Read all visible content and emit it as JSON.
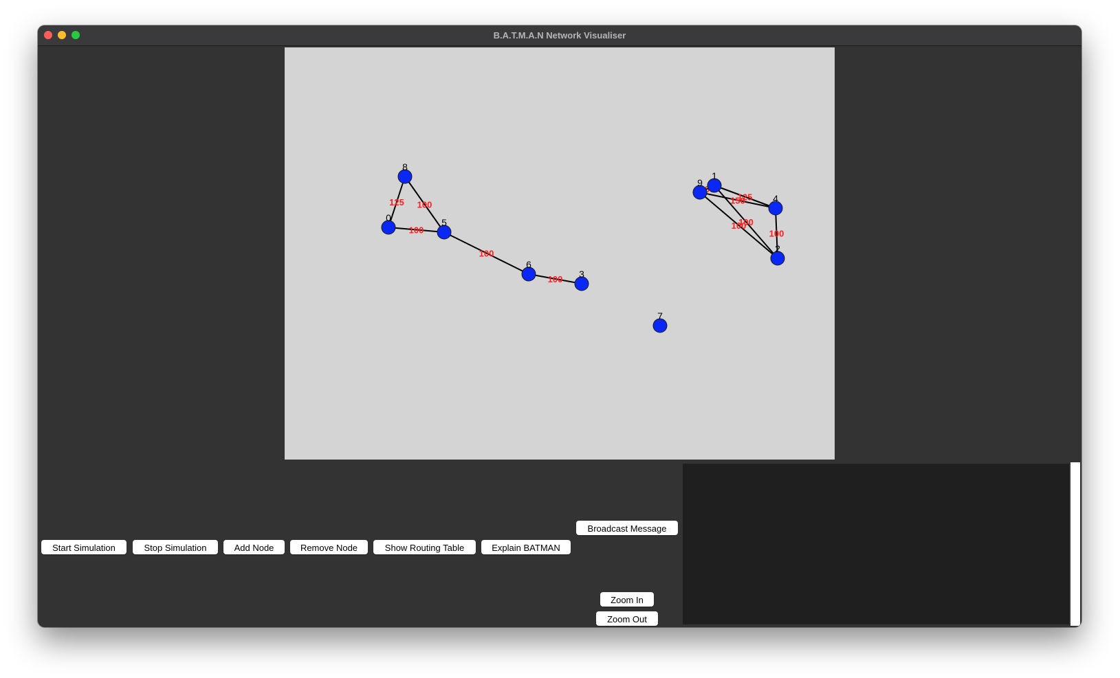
{
  "window": {
    "title": "B.A.T.M.A.N Network Visualiser"
  },
  "toolbar": {
    "start_label": "Start Simulation",
    "stop_label": "Stop Simulation",
    "add_label": "Add Node",
    "remove_label": "Remove Node",
    "routing_label": "Show Routing Table",
    "explain_label": "Explain BATMAN",
    "broadcast_label": "Broadcast Message",
    "zoom_in_label": "Zoom In",
    "zoom_out_label": "Zoom Out"
  },
  "network": {
    "nodes": [
      {
        "id": "0"
      },
      {
        "id": "1"
      },
      {
        "id": "2"
      },
      {
        "id": "3"
      },
      {
        "id": "4"
      },
      {
        "id": "5"
      },
      {
        "id": "6"
      },
      {
        "id": "7"
      },
      {
        "id": "8"
      },
      {
        "id": "9"
      }
    ],
    "edges": [
      {
        "from": "8",
        "to": "0",
        "label": "125"
      },
      {
        "from": "8",
        "to": "5",
        "label": "100"
      },
      {
        "from": "0",
        "to": "5",
        "label": "100"
      },
      {
        "from": "5",
        "to": "6",
        "label": "100"
      },
      {
        "from": "6",
        "to": "3",
        "label": "100"
      },
      {
        "from": "9",
        "to": "1",
        "label": "100"
      },
      {
        "from": "1",
        "to": "4",
        "label": "125"
      },
      {
        "from": "9",
        "to": "4",
        "label": "150"
      },
      {
        "from": "1",
        "to": "2",
        "label": "100"
      },
      {
        "from": "9",
        "to": "2",
        "label": "100"
      },
      {
        "from": "4",
        "to": "2",
        "label": "100"
      }
    ]
  },
  "colors": {
    "node_fill": "#0a28f5",
    "edge": "#000000",
    "edge_label": "#ff2020",
    "canvas_bg": "#d4d4d4",
    "window_bg": "#333333",
    "log_bg": "#1f1f1f"
  }
}
